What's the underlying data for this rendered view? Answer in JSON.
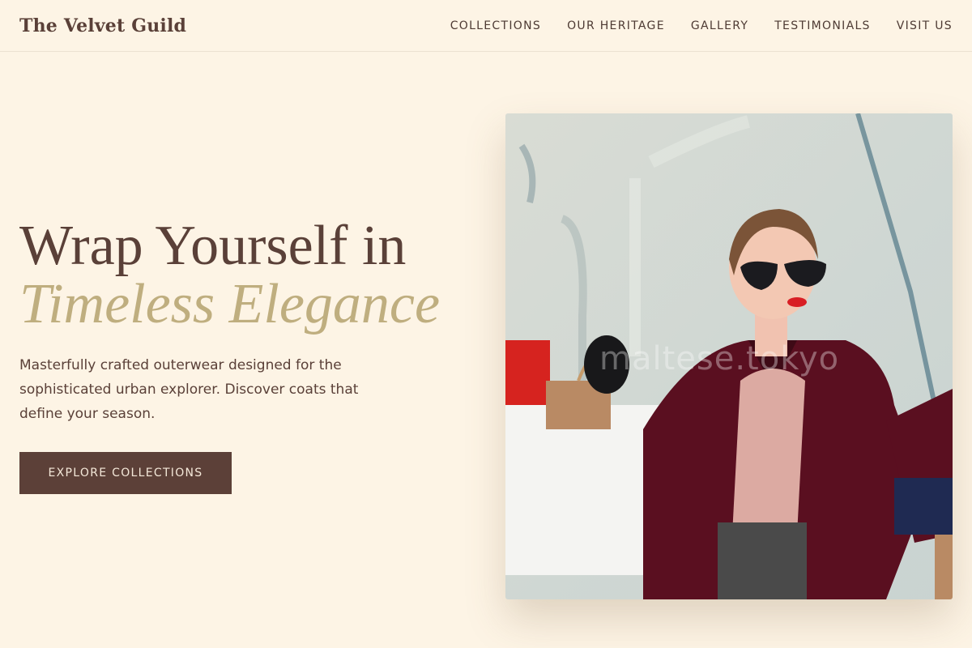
{
  "brand": {
    "name": "The Velvet Guild"
  },
  "nav": {
    "items": [
      "COLLECTIONS",
      "OUR HERITAGE",
      "GALLERY",
      "TESTIMONIALS",
      "VISIT US"
    ]
  },
  "hero": {
    "headline": "Wrap Yourself in",
    "headline_accent": "Timeless Elegance",
    "description": "Masterfully crafted outerwear designed for the sophisticated urban explorer. Discover coats that define your season.",
    "cta_label": "EXPLORE COLLECTIONS",
    "image_watermark": "maltese.tokyo"
  },
  "colors": {
    "background": "#fdf4e5",
    "primary_text": "#5a4038",
    "accent_gold": "#bfae7f",
    "button": "#5c4038"
  }
}
